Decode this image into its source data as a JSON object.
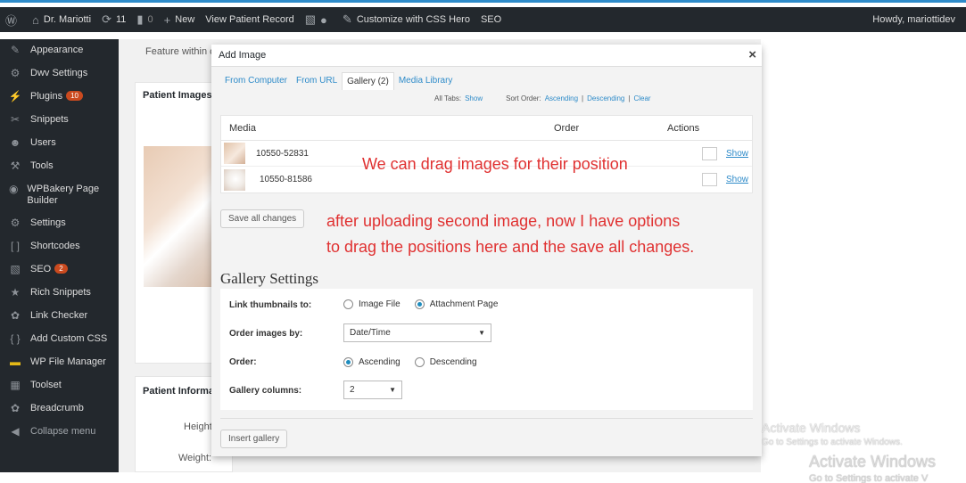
{
  "adminbar": {
    "site_name": "Dr. Mariotti",
    "updates_count": "11",
    "comments_count": "0",
    "new_label": "New",
    "view_record": "View Patient Record",
    "customize": "Customize with CSS Hero",
    "seo": "SEO",
    "howdy": "Howdy, mariottidev"
  },
  "sidebar": {
    "items": [
      {
        "label": "Appearance",
        "icon": "brush-icon"
      },
      {
        "label": "Dwv Settings",
        "icon": "settings-icon"
      },
      {
        "label": "Plugins",
        "icon": "plugin-icon",
        "badge": "10"
      },
      {
        "label": "Snippets",
        "icon": "snippet-icon"
      },
      {
        "label": "Users",
        "icon": "user-icon"
      },
      {
        "label": "Tools",
        "icon": "wrench-icon"
      },
      {
        "label": "WPBakery Page Builder",
        "icon": "builder-icon"
      },
      {
        "label": "Settings",
        "icon": "settings-icon"
      },
      {
        "label": "Shortcodes",
        "icon": "brackets-icon"
      },
      {
        "label": "SEO",
        "icon": "seo-icon",
        "badge": "2"
      },
      {
        "label": "Rich Snippets",
        "icon": "star-icon"
      },
      {
        "label": "Link Checker",
        "icon": "gear-icon"
      },
      {
        "label": "Add Custom CSS",
        "icon": "braces-icon"
      },
      {
        "label": "WP File Manager",
        "icon": "folder-icon"
      },
      {
        "label": "Toolset",
        "icon": "toolset-icon"
      },
      {
        "label": "Breadcrumb",
        "icon": "gear-icon"
      },
      {
        "label": "Collapse menu",
        "icon": "collapse-icon"
      }
    ]
  },
  "background": {
    "feature_text": "Feature within c",
    "patient_images": "Patient Images",
    "patient_info": "Patient Informa",
    "height_label": "Height",
    "weight_label": "Weight:"
  },
  "modal": {
    "title": "Add Image",
    "close": "×",
    "tabs": [
      "From Computer",
      "From URL",
      "Gallery (2)",
      "Media Library"
    ],
    "all_tabs_label": "All Tabs:",
    "all_tabs_show": "Show",
    "sort_order_label": "Sort Order:",
    "sort_ascending": "Ascending",
    "sort_descending": "Descending",
    "sort_clear": "Clear",
    "table": {
      "columns": [
        "Media",
        "Order",
        "Actions"
      ],
      "rows": [
        {
          "name": "10550-52831",
          "action": "Show"
        },
        {
          "name": "10550-81586",
          "action": "Show"
        }
      ]
    },
    "save_all": "Save all changes",
    "gallery_settings_title": "Gallery Settings",
    "link_thumbnails_label": "Link thumbnails to:",
    "link_options": [
      "Image File",
      "Attachment Page"
    ],
    "order_by_label": "Order images by:",
    "order_by_value": "Date/Time",
    "order_label": "Order:",
    "order_options": [
      "Ascending",
      "Descending"
    ],
    "columns_label": "Gallery columns:",
    "columns_value": "2",
    "insert_gallery": "Insert gallery"
  },
  "annotations": {
    "drag_note": "We can drag images for their position",
    "line1": "after uploading second image, now I have options",
    "line2": "to drag the positions here and the save all changes."
  },
  "watermark": {
    "title": "Activate Windows",
    "subtitle": "Go to Settings to activate Windows.",
    "title2": "Activate Windows",
    "subtitle2": "Go to Settings to activate V"
  }
}
